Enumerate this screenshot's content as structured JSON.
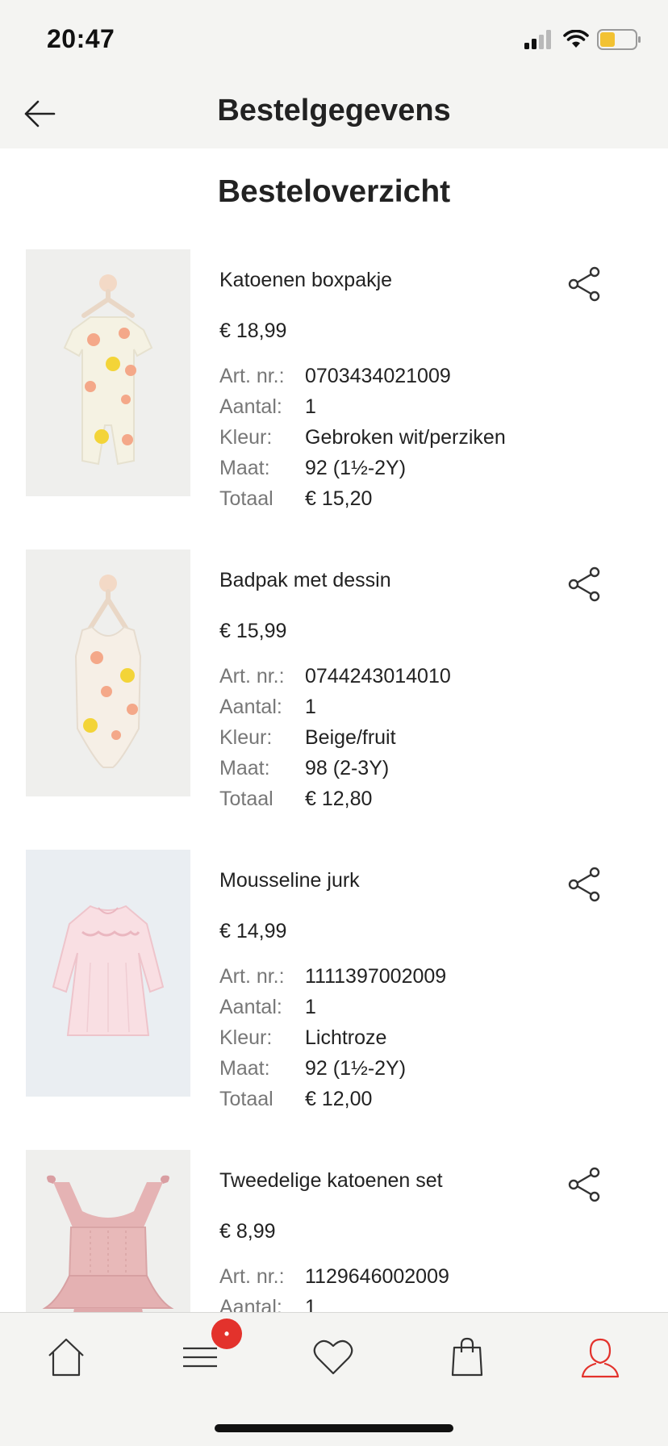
{
  "status": {
    "time": "20:47"
  },
  "nav": {
    "title": "Bestelgegevens"
  },
  "section_title": "Besteloverzicht",
  "labels": {
    "art_nr": "Art. nr.:",
    "aantal": "Aantal:",
    "kleur": "Kleur:",
    "maat": "Maat:",
    "totaal": "Totaal"
  },
  "items": [
    {
      "name": "Katoenen boxpakje",
      "price": "€ 18,99",
      "art_nr": "0703434021009",
      "aantal": "1",
      "kleur": "Gebroken wit/perziken",
      "maat": "92 (1½-2Y)",
      "totaal": "€ 15,20"
    },
    {
      "name": "Badpak met dessin",
      "price": "€ 15,99",
      "art_nr": "0744243014010",
      "aantal": "1",
      "kleur": "Beige/fruit",
      "maat": "98 (2-3Y)",
      "totaal": "€ 12,80"
    },
    {
      "name": "Mousseline jurk",
      "price": "€ 14,99",
      "art_nr": "1111397002009",
      "aantal": "1",
      "kleur": "Lichtroze",
      "maat": "92 (1½-2Y)",
      "totaal": "€ 12,00"
    },
    {
      "name": "Tweedelige katoenen set",
      "price": "€ 8,99",
      "art_nr": "1129646002009",
      "aantal": "1"
    }
  ],
  "tab_bar": {
    "badge": "•",
    "icons": [
      "home-icon",
      "menu-icon",
      "heart-icon",
      "shopping-bag-icon",
      "account-icon"
    ]
  },
  "colors": {
    "accent": "#e3322c",
    "background": "#f4f4f2",
    "text": "#222222",
    "muted": "#777777"
  }
}
